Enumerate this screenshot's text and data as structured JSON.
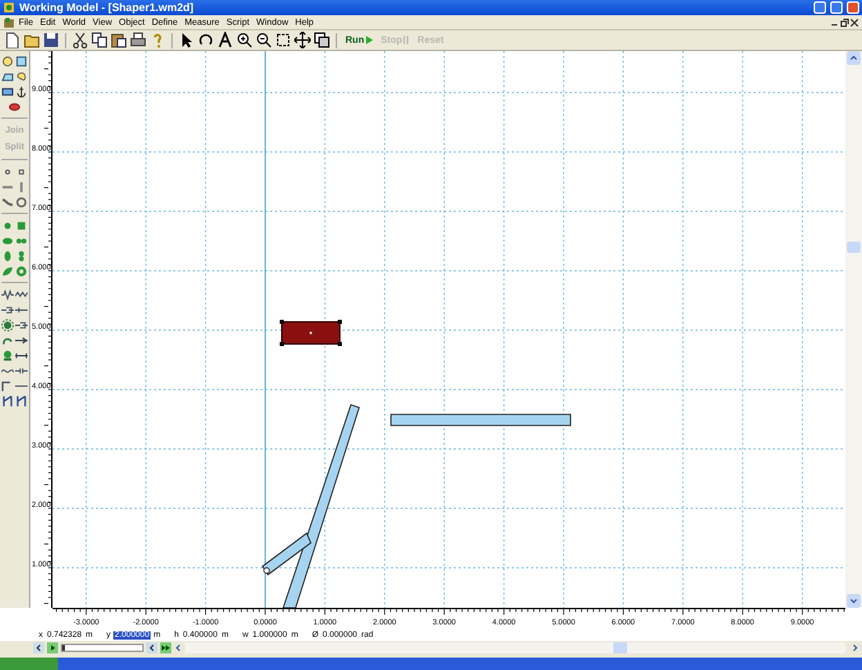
{
  "window": {
    "title": "Working Model - [Shaper1.wm2d]"
  },
  "menu": [
    "File",
    "Edit",
    "World",
    "View",
    "Object",
    "Define",
    "Measure",
    "Script",
    "Window",
    "Help"
  ],
  "run_controls": [
    {
      "label": "Run",
      "disabled": false
    },
    {
      "label": "Stop",
      "disabled": true
    },
    {
      "label": "Reset",
      "disabled": true
    }
  ],
  "toolbox": {
    "actions": [
      {
        "label": "Join",
        "disabled": true
      },
      {
        "label": "Split",
        "disabled": true
      }
    ]
  },
  "rulers": {
    "vertical": [
      "9.000",
      "8.000",
      "7.000",
      "6.000",
      "5.000",
      "4.000",
      "3.000",
      "2.000",
      "1.000"
    ],
    "horizontal": [
      "-3.0000",
      "-2.0000",
      "-1.0000",
      "0.0000",
      "1.0000",
      "2.0000",
      "3.0000",
      "4.0000",
      "5.0000",
      "6.0000",
      "7.0000",
      "8.0000",
      "9.0000"
    ]
  },
  "frame_slider": {
    "level": 0
  },
  "status_fields": [
    {
      "label": "x",
      "value": "0.742328",
      "unit": "m",
      "selected": false
    },
    {
      "label": "y",
      "value": "2.000000",
      "unit": "m",
      "selected": true
    },
    {
      "label": "h",
      "value": "0.400000",
      "unit": "m",
      "selected": false
    },
    {
      "label": "w",
      "value": "1.000000",
      "unit": "m",
      "selected": false
    },
    {
      "label": "Ø",
      "value": "0.000000",
      "unit": "rad",
      "selected": false
    }
  ]
}
